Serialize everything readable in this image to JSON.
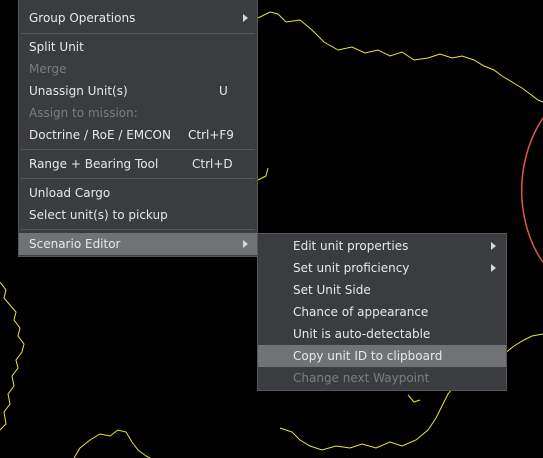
{
  "context_menu": {
    "items": [
      {
        "label": "Group Operations",
        "shortcut": "",
        "disabled": false
      },
      {
        "label": "Split Unit",
        "shortcut": "",
        "disabled": false
      },
      {
        "label": "Merge",
        "shortcut": "",
        "disabled": true
      },
      {
        "label": "Unassign Unit(s)",
        "shortcut": "U",
        "disabled": false
      },
      {
        "label": "Assign to mission:",
        "shortcut": "",
        "disabled": true
      },
      {
        "label": "Doctrine / RoE / EMCON",
        "shortcut": "Ctrl+F9",
        "disabled": false
      },
      {
        "label": "Range + Bearing Tool",
        "shortcut": "Ctrl+D",
        "disabled": false
      },
      {
        "label": "Unload Cargo",
        "shortcut": "",
        "disabled": false
      },
      {
        "label": "Select unit(s) to pickup",
        "shortcut": "",
        "disabled": false
      },
      {
        "label": "Scenario Editor",
        "shortcut": "",
        "disabled": false
      }
    ]
  },
  "scenario_editor_submenu": {
    "items": [
      {
        "label": "Edit unit properties",
        "disabled": false
      },
      {
        "label": "Set unit proficiency",
        "disabled": false
      },
      {
        "label": "Set Unit Side",
        "disabled": false
      },
      {
        "label": "Chance of appearance",
        "disabled": false
      },
      {
        "label": "Unit is auto-detectable",
        "disabled": false
      },
      {
        "label": "Copy unit ID to clipboard",
        "disabled": false
      },
      {
        "label": "Change next Waypoint",
        "disabled": true
      }
    ]
  },
  "colors": {
    "map_background": "#000000",
    "border_line": "#e8e83a",
    "range_circle": "#e05555",
    "menu_background": "#3a3c3f",
    "highlight": "#707275",
    "disabled_text": "#7b7d80"
  },
  "icons": {
    "submenu_arrow": "chevron-right-icon"
  }
}
